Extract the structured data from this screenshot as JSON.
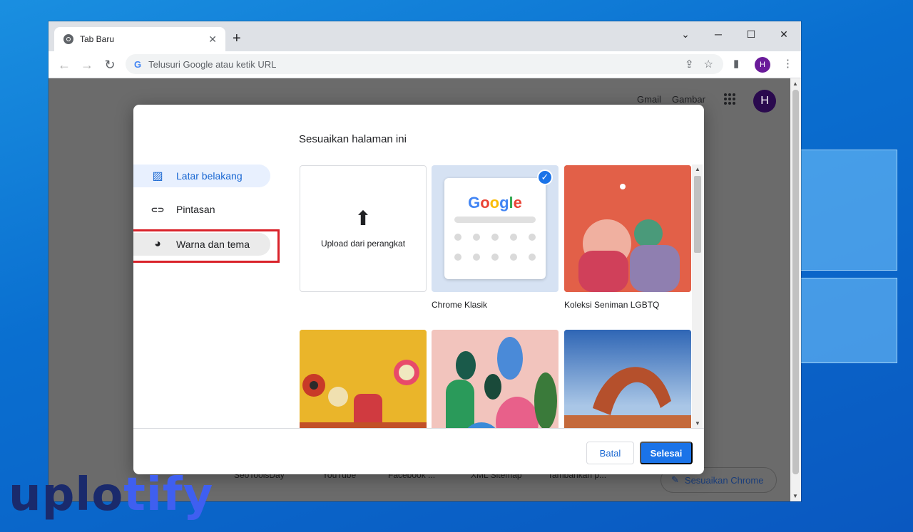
{
  "desktop": {
    "watermark_text_1": "uplo",
    "watermark_text_2": "tify"
  },
  "browser": {
    "tab": {
      "title": "Tab Baru",
      "close": "✕",
      "favicon": "chrome-icon"
    },
    "new_tab": "+",
    "window_controls": {
      "minimize": "─",
      "maximize": "☐",
      "close": "✕",
      "tab_search": "⌄"
    },
    "toolbar": {
      "back": "←",
      "forward": "→",
      "reload": "↻",
      "omnibox_placeholder": "Telusuri Google atau ketik URL",
      "google_g": "G",
      "share": "⇪",
      "bookmark": "☆",
      "side_panel": "▮",
      "menu": "⋮",
      "avatar_letter": "H"
    }
  },
  "newtab_page": {
    "gmail": "Gmail",
    "images": "Gambar",
    "apps": "⋮⋮⋮",
    "avatar_letter": "H",
    "shortcuts": [
      "SeoToolsDay",
      "YouTube",
      "Facebook ...",
      "XML Sitemap",
      "Tambahkan p..."
    ],
    "customize_chrome": "Sesuaikan Chrome",
    "pencil": "✎"
  },
  "dialog": {
    "title": "Sesuaikan halaman ini",
    "menu": [
      {
        "label": "Latar belakang",
        "icon": "▨"
      },
      {
        "label": "Pintasan",
        "icon": "⊂⊃"
      },
      {
        "label": "Warna dan tema",
        "icon": "◕"
      }
    ],
    "tiles": {
      "upload": "Upload dari perangkat",
      "upload_icon": "⬆",
      "classic_label": "Chrome Klasik",
      "classic_logo": "Google",
      "check": "✓",
      "lgbtq_label": "Koleksi Seniman LGBTQ"
    },
    "buttons": {
      "cancel": "Batal",
      "done": "Selesai"
    }
  },
  "colors": {
    "accent": "#1a73e8",
    "highlight_box": "#d9222a",
    "active_menu_bg": "#e8f0fe"
  }
}
